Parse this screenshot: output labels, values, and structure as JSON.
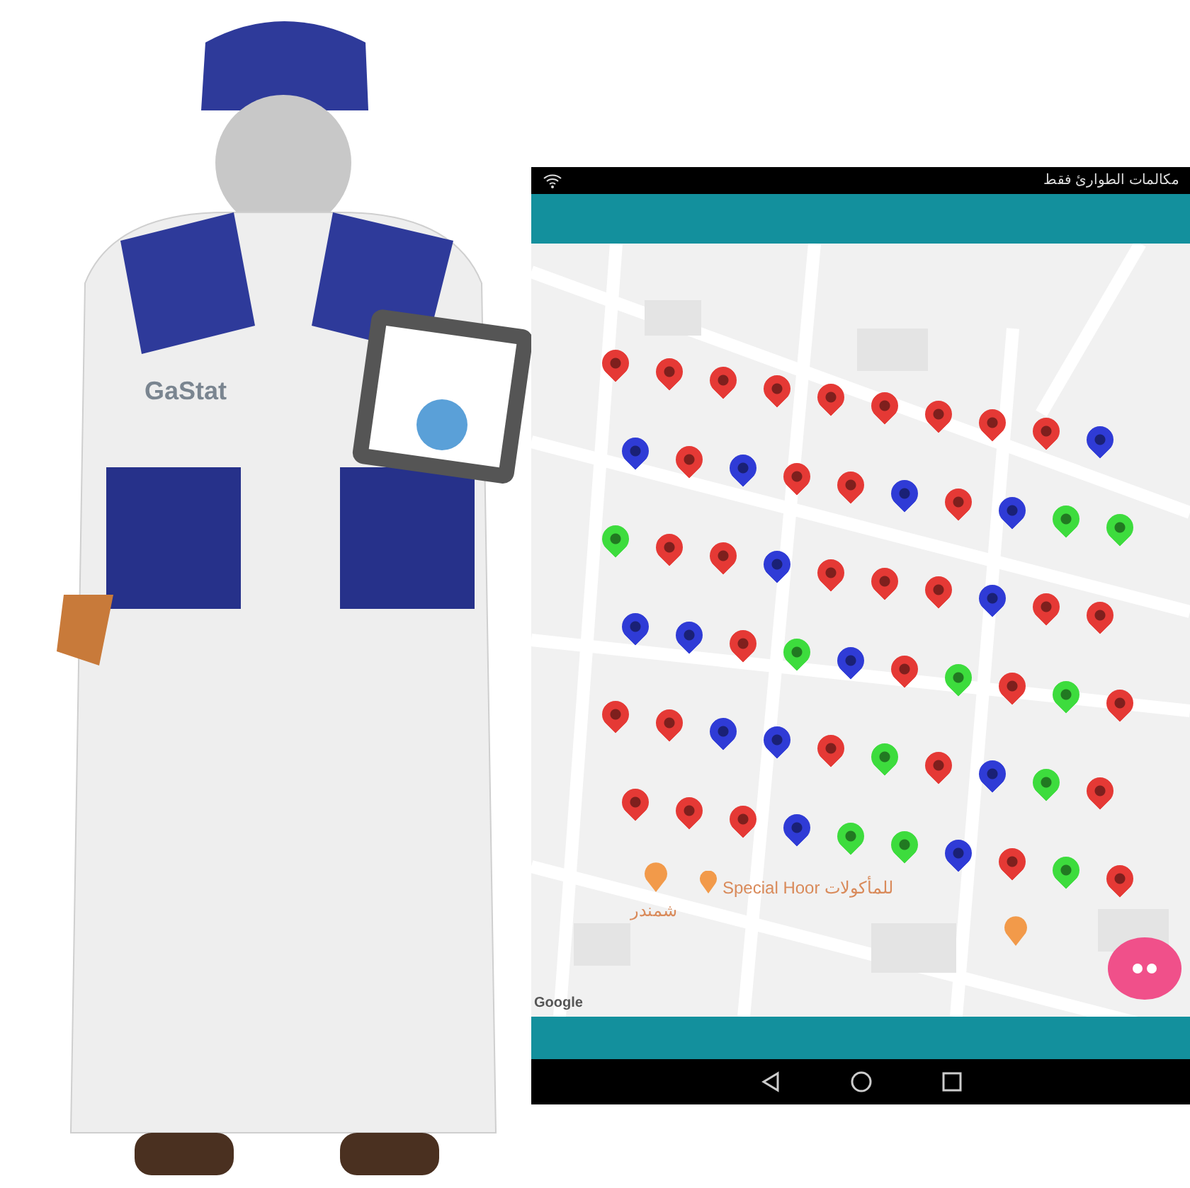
{
  "illustration": {
    "vest_text": "GaStat"
  },
  "phone": {
    "status_bar": {
      "text": "مكالمات الطوارئ فقط"
    },
    "map": {
      "labels": [
        {
          "text": "Special Hoor للمأكولات",
          "kind": "restaurant"
        },
        {
          "text": "شمندر",
          "kind": "plain"
        }
      ],
      "attribution": "Google",
      "markers": [
        {
          "color": "#e53935"
        },
        {
          "color": "#e53935"
        },
        {
          "color": "#e53935"
        },
        {
          "color": "#e53935"
        },
        {
          "color": "#e53935"
        },
        {
          "color": "#e53935"
        },
        {
          "color": "#e53935"
        },
        {
          "color": "#e53935"
        },
        {
          "color": "#e53935"
        },
        {
          "color": "#2f3bd6"
        },
        {
          "color": "#2f3bd6"
        },
        {
          "color": "#e53935"
        },
        {
          "color": "#2f3bd6"
        },
        {
          "color": "#e53935"
        },
        {
          "color": "#e53935"
        },
        {
          "color": "#2f3bd6"
        },
        {
          "color": "#e53935"
        },
        {
          "color": "#2f3bd6"
        },
        {
          "color": "#3ddc3d"
        },
        {
          "color": "#3ddc3d"
        },
        {
          "color": "#3ddc3d"
        },
        {
          "color": "#e53935"
        },
        {
          "color": "#e53935"
        },
        {
          "color": "#2f3bd6"
        },
        {
          "color": "#e53935"
        },
        {
          "color": "#e53935"
        },
        {
          "color": "#e53935"
        },
        {
          "color": "#2f3bd6"
        },
        {
          "color": "#e53935"
        },
        {
          "color": "#e53935"
        },
        {
          "color": "#2f3bd6"
        },
        {
          "color": "#2f3bd6"
        },
        {
          "color": "#e53935"
        },
        {
          "color": "#3ddc3d"
        },
        {
          "color": "#2f3bd6"
        },
        {
          "color": "#e53935"
        },
        {
          "color": "#3ddc3d"
        },
        {
          "color": "#e53935"
        },
        {
          "color": "#3ddc3d"
        },
        {
          "color": "#e53935"
        },
        {
          "color": "#e53935"
        },
        {
          "color": "#e53935"
        },
        {
          "color": "#2f3bd6"
        },
        {
          "color": "#2f3bd6"
        },
        {
          "color": "#e53935"
        },
        {
          "color": "#3ddc3d"
        },
        {
          "color": "#e53935"
        },
        {
          "color": "#2f3bd6"
        },
        {
          "color": "#3ddc3d"
        },
        {
          "color": "#e53935"
        },
        {
          "color": "#e53935"
        },
        {
          "color": "#e53935"
        },
        {
          "color": "#e53935"
        },
        {
          "color": "#2f3bd6"
        },
        {
          "color": "#3ddc3d"
        },
        {
          "color": "#3ddc3d"
        },
        {
          "color": "#2f3bd6"
        },
        {
          "color": "#e53935"
        },
        {
          "color": "#3ddc3d"
        },
        {
          "color": "#e53935"
        }
      ]
    }
  }
}
